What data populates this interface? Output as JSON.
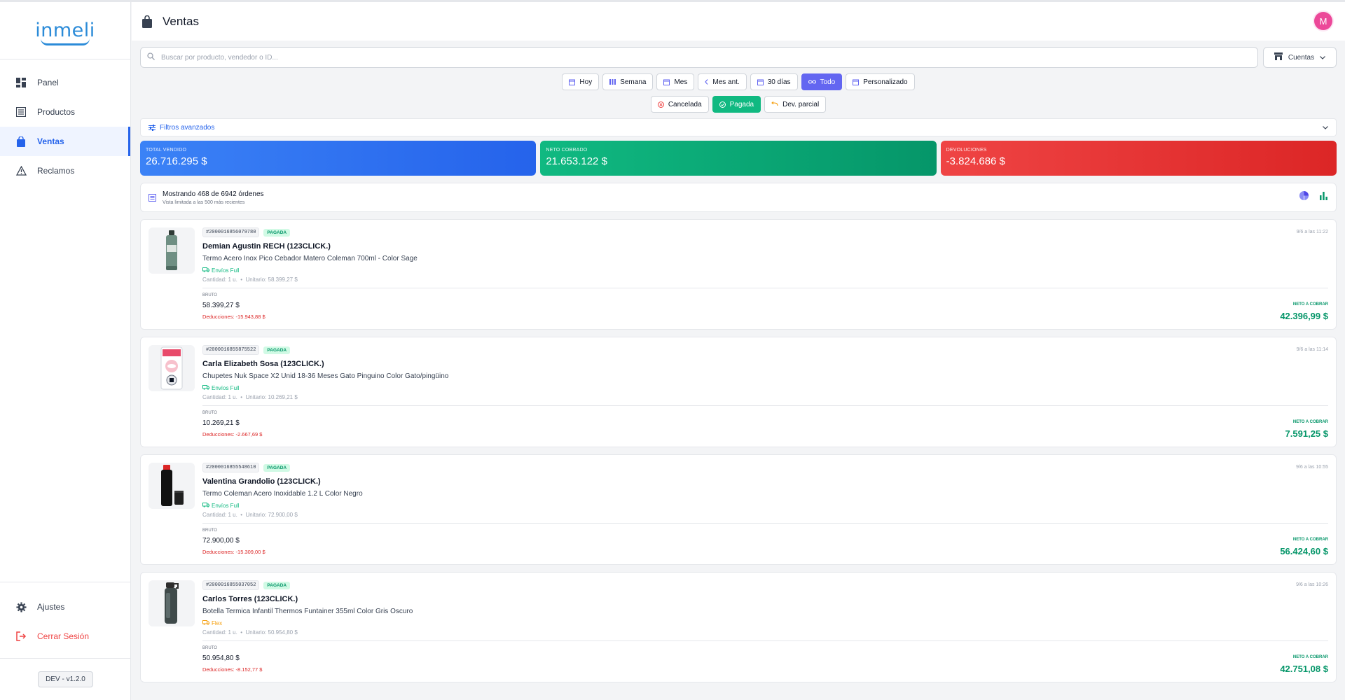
{
  "app": {
    "logo_text": "inmeli",
    "version": "DEV - v1.2.0"
  },
  "sidebar": {
    "items": [
      {
        "label": "Panel",
        "icon": "dashboard-icon"
      },
      {
        "label": "Productos",
        "icon": "list-icon"
      },
      {
        "label": "Ventas",
        "icon": "bag-icon",
        "active": true
      },
      {
        "label": "Reclamos",
        "icon": "warning-icon"
      }
    ],
    "bottom": [
      {
        "label": "Ajustes",
        "icon": "gear-icon"
      },
      {
        "label": "Cerrar Sesión",
        "icon": "logout-icon"
      }
    ]
  },
  "header": {
    "title": "Ventas",
    "avatar_initial": "M"
  },
  "search": {
    "placeholder": "Buscar por producto, vendedor o ID..."
  },
  "accounts": {
    "label": "Cuentas"
  },
  "date_filters": [
    "Hoy",
    "Semana",
    "Mes",
    "Mes ant.",
    "30 días",
    "Todo",
    "Personalizado"
  ],
  "status_filters": [
    "Cancelada",
    "Pagada",
    "Dev. parcial"
  ],
  "advanced_filters": {
    "label": "Filtros avanzados"
  },
  "stats": [
    {
      "label": "TOTAL VENDIDO",
      "value": "26.716.295 $",
      "color": "#2563eb"
    },
    {
      "label": "NETO COBRADO",
      "value": "21.653.122 $",
      "color": "#059669"
    },
    {
      "label": "DEVOLUCIONES",
      "value": "-3.824.686 $",
      "color": "#dc2626"
    }
  ],
  "summary": {
    "title": "Mostrando 468 de 6942 órdenes",
    "subtitle": "Vista limitada a las 500 más recientes"
  },
  "orders": [
    {
      "id": "#2000016856079780",
      "status": "PAGADA",
      "time": "9/6 a las 11:22",
      "buyer": "Demian Agustin RECH (123CLICK.)",
      "product": "Termo Acero Inox Pico Cebador Matero Coleman 700ml - Color Sage",
      "shipping": "Envíos Full",
      "quantity": "Cantidad: 1 u.",
      "unit": "Unitario: 58.399,27 $",
      "bruto_label": "BRUTO",
      "bruto": "58.399,27 $",
      "deductions": "Deducciones: -15.943,88 $",
      "net_label": "NETO A COBRAR",
      "net": "42.396,99 $"
    },
    {
      "id": "#2000016855875522",
      "status": "PAGADA",
      "time": "9/6 a las 11:14",
      "buyer": "Carla Elizabeth Sosa (123CLICK.)",
      "product": "Chupetes Nuk Space X2 Unid 18-36 Meses Gato Pinguino Color Gato/pingüino",
      "shipping": "Envíos Full",
      "quantity": "Cantidad: 1 u.",
      "unit": "Unitario: 10.269,21 $",
      "bruto_label": "BRUTO",
      "bruto": "10.269,21 $",
      "deductions": "Deducciones: -2.667,69 $",
      "net_label": "NETO A COBRAR",
      "net": "7.591,25 $"
    },
    {
      "id": "#2000016855548610",
      "status": "PAGADA",
      "time": "9/6 a las 10:55",
      "buyer": "Valentina Grandolio (123CLICK.)",
      "product": "Termo Coleman Acero Inoxidable 1.2 L Color Negro",
      "shipping": "Envíos Full",
      "quantity": "Cantidad: 1 u.",
      "unit": "Unitario: 72.900,00 $",
      "bruto_label": "BRUTO",
      "bruto": "72.900,00 $",
      "deductions": "Deducciones: -15.309,00 $",
      "net_label": "NETO A COBRAR",
      "net": "56.424,60 $"
    },
    {
      "id": "#2000016855037052",
      "status": "PAGADA",
      "time": "9/6 a las 10:26",
      "buyer": "Carlos Torres (123CLICK.)",
      "product": "Botella Termica Infantil Thermos Funtainer 355ml Color Gris Oscuro",
      "shipping": "Flex",
      "quantity": "Cantidad: 1 u.",
      "unit": "Unitario: 50.954,80 $",
      "bruto_label": "BRUTO",
      "bruto": "50.954,80 $",
      "deductions": "Deducciones: -8.152,77 $",
      "net_label": "NETO A COBRAR",
      "net": "42.751,08 $"
    }
  ]
}
